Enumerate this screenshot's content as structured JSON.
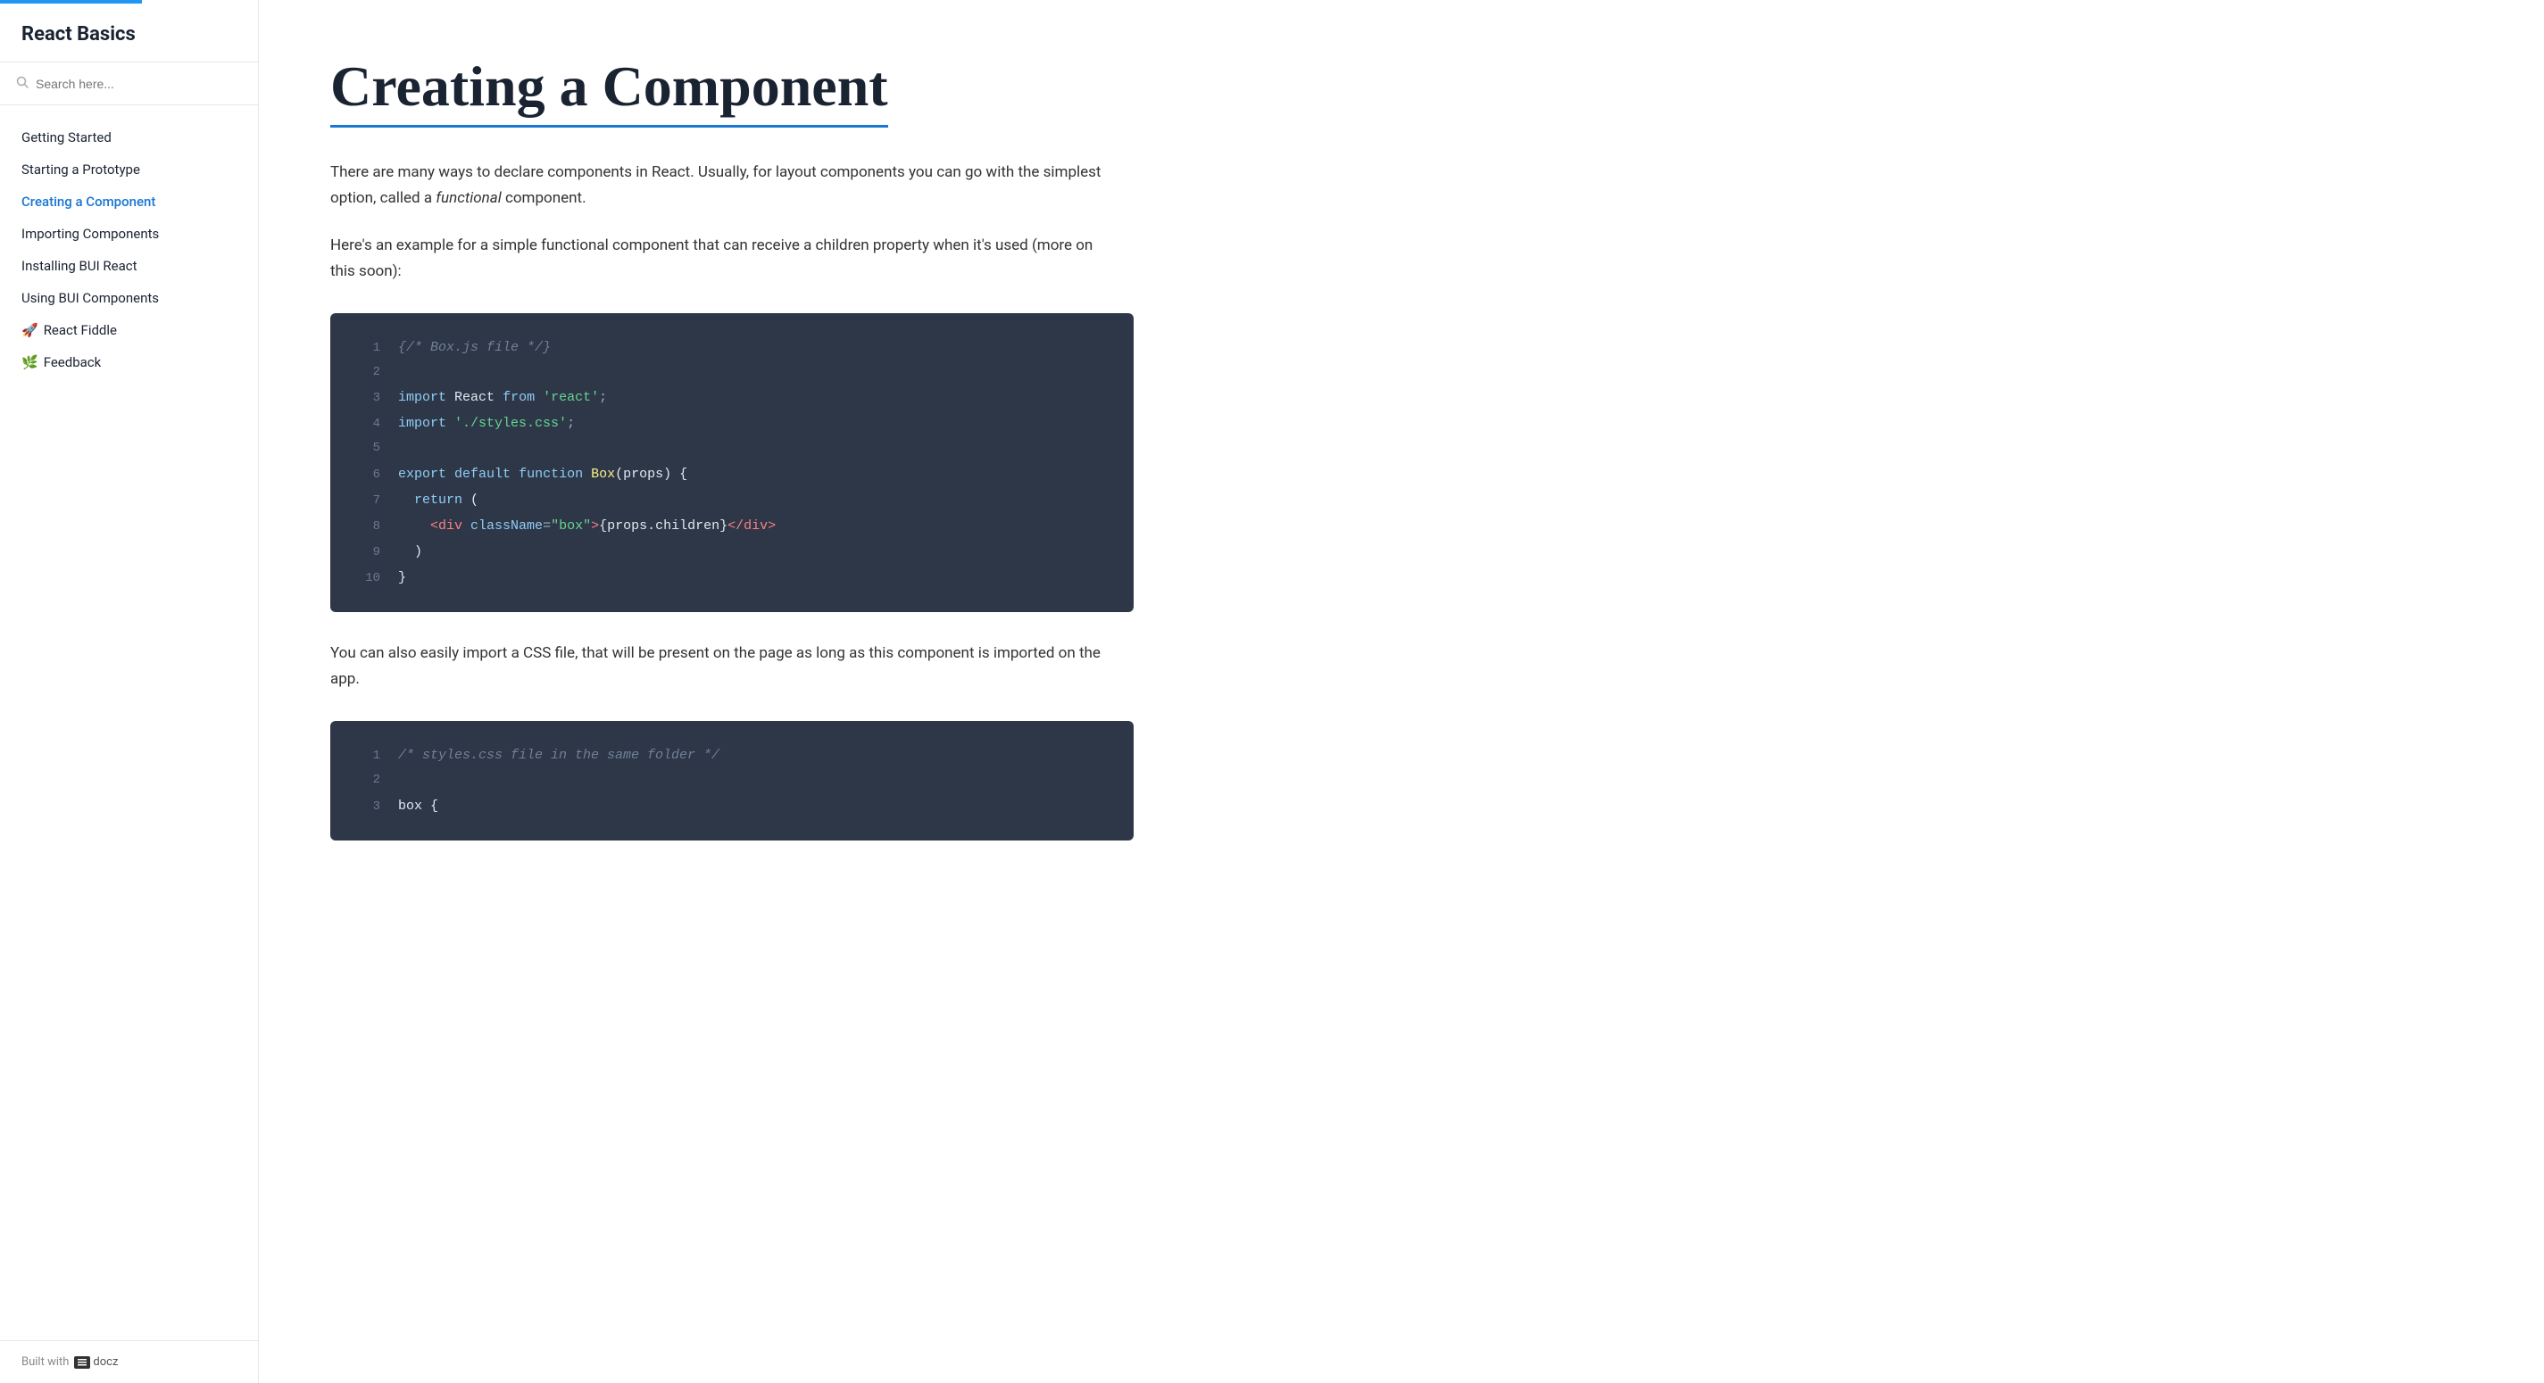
{
  "sidebar": {
    "top_bar_color": "#2196f3",
    "title": "React Basics",
    "search": {
      "placeholder": "Search here..."
    },
    "nav_items": [
      {
        "id": "getting-started",
        "label": "Getting Started",
        "active": false,
        "emoji": ""
      },
      {
        "id": "starting-prototype",
        "label": "Starting a Prototype",
        "active": false,
        "emoji": ""
      },
      {
        "id": "creating-component",
        "label": "Creating a Component",
        "active": true,
        "emoji": ""
      },
      {
        "id": "importing-components",
        "label": "Importing Components",
        "active": false,
        "emoji": ""
      },
      {
        "id": "installing-bui",
        "label": "Installing BUI React",
        "active": false,
        "emoji": ""
      },
      {
        "id": "using-bui",
        "label": "Using BUI Components",
        "active": false,
        "emoji": ""
      },
      {
        "id": "react-fiddle",
        "label": "React Fiddle",
        "active": false,
        "emoji": "🚀"
      },
      {
        "id": "feedback",
        "label": "Feedback",
        "active": false,
        "emoji": "🌿"
      }
    ],
    "footer": {
      "prefix": "Built with",
      "brand": "docz"
    }
  },
  "main": {
    "page_title": "Creating a Component",
    "paragraphs": [
      "There are many ways to declare components in React. Usually, for layout components you can go with the simplest option, called a functional component.",
      "Here's an example for a simple functional component that can receive a children property when it's used (more on this soon):"
    ],
    "second_paragraph_italic": "functional",
    "after_code_text": "You can also easily import a CSS file, that will be present on the page as long as this component is imported on the app.",
    "code_block_1": {
      "lines": [
        {
          "num": 1,
          "content": "{/* Box.js file */}"
        },
        {
          "num": 2,
          "content": ""
        },
        {
          "num": 3,
          "content": "import React from 'react';"
        },
        {
          "num": 4,
          "content": "import './styles.css';"
        },
        {
          "num": 5,
          "content": ""
        },
        {
          "num": 6,
          "content": "export default function Box(props) {"
        },
        {
          "num": 7,
          "content": "  return ("
        },
        {
          "num": 8,
          "content": "    <div className=\"box\">{props.children}</div>"
        },
        {
          "num": 9,
          "content": "  )"
        },
        {
          "num": 10,
          "content": "}"
        }
      ]
    },
    "code_block_2": {
      "lines": [
        {
          "num": 1,
          "content": "/* styles.css file in the same folder */"
        },
        {
          "num": 2,
          "content": ""
        },
        {
          "num": 3,
          "content": "box {"
        }
      ]
    }
  }
}
